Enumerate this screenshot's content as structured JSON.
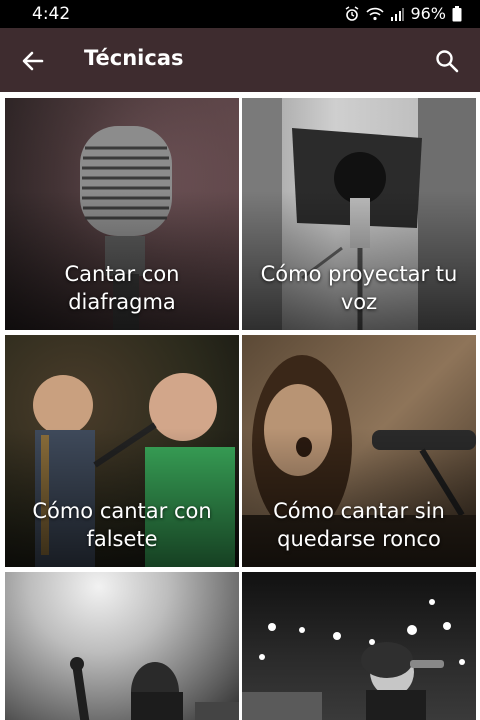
{
  "status_bar": {
    "time": "4:42",
    "battery": "96%",
    "icons": [
      "alarm-icon",
      "wifi-icon",
      "signal-icon",
      "battery-icon"
    ]
  },
  "app_bar": {
    "title": "Técnicas",
    "back_icon": "arrow-left-icon",
    "search_icon": "search-icon",
    "background": "#3e2c2f"
  },
  "cards": [
    {
      "label": "Cantar con diafragma"
    },
    {
      "label": "Cómo proyectar tu voz"
    },
    {
      "label": "Cómo cantar con falsete"
    },
    {
      "label": "Cómo cantar sin quedarse ronco"
    },
    {
      "label": ""
    },
    {
      "label": ""
    }
  ]
}
